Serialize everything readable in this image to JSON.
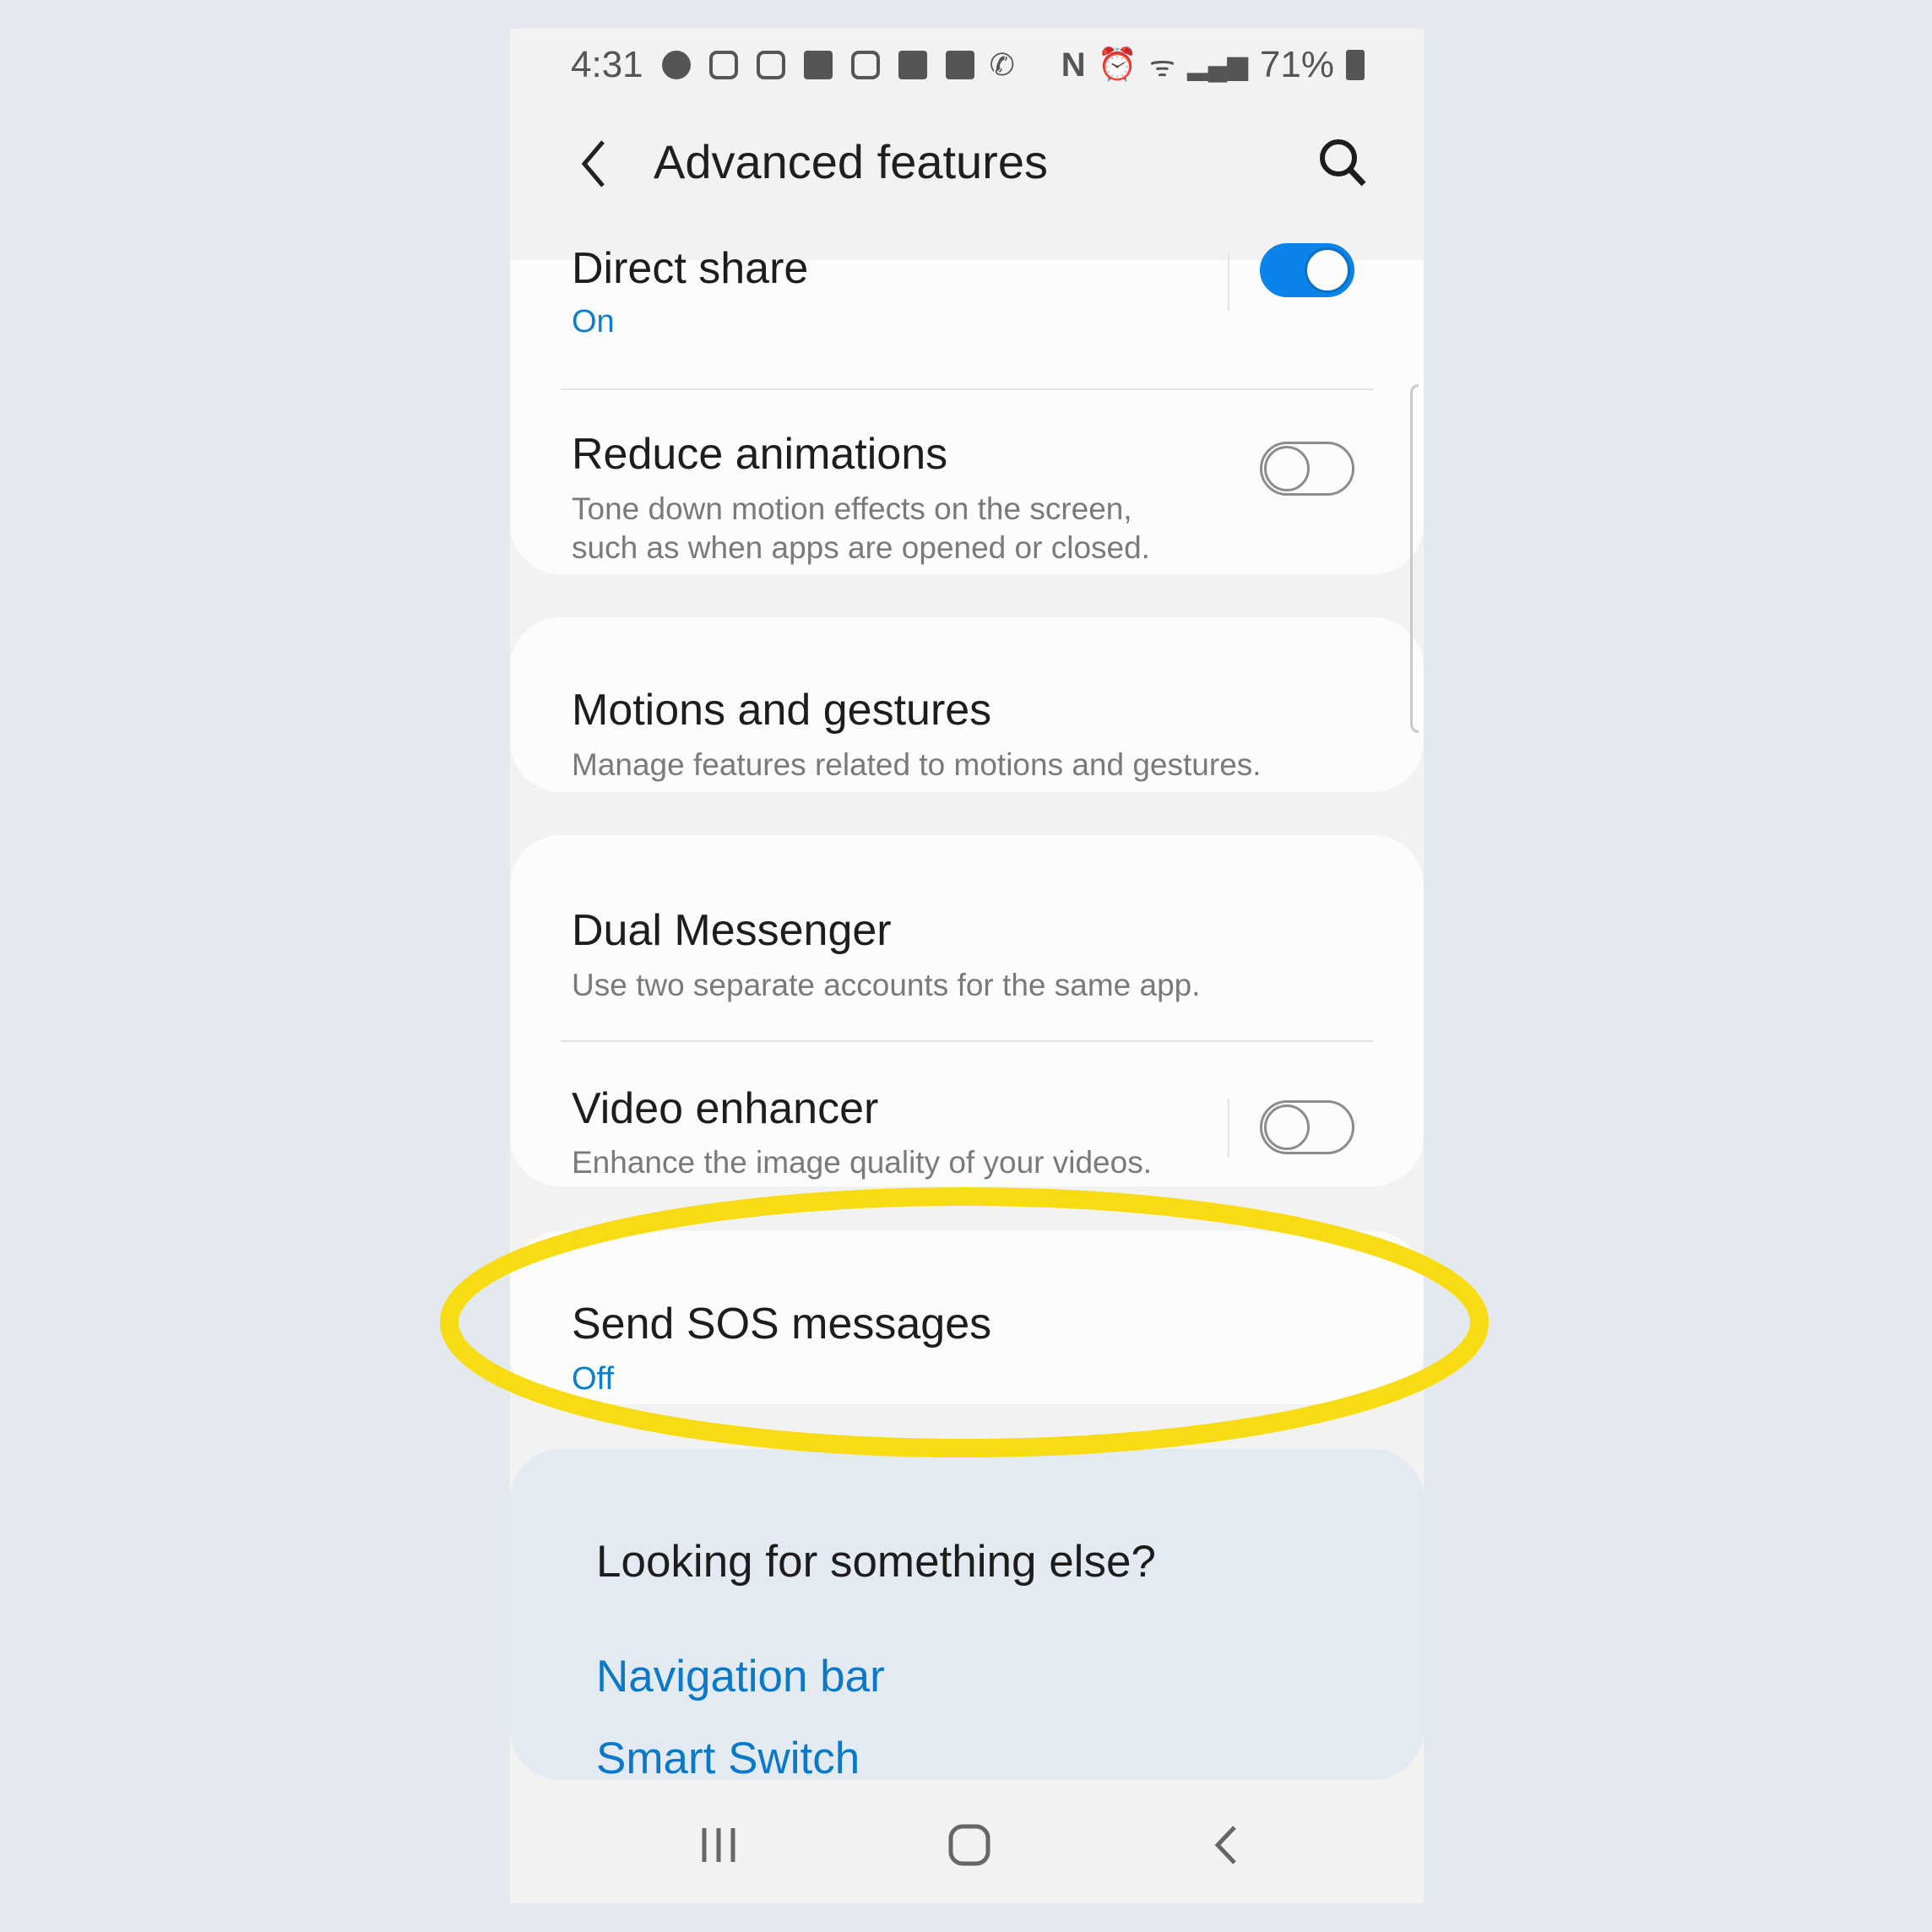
{
  "status_bar": {
    "time": "4:31",
    "battery": "71%",
    "notification_icons": [
      "music-icon",
      "instagram-icon",
      "instagram-icon",
      "message-icon",
      "instagram-icon",
      "email-icon",
      "gallery-icon",
      "call-icon"
    ],
    "system_icons": [
      "nfc-icon",
      "alarm-icon",
      "wifi-icon",
      "signal-icon",
      "battery-icon"
    ]
  },
  "header": {
    "title": "Advanced features",
    "back_icon": "chevron-left-icon",
    "search_icon": "search-icon"
  },
  "items": [
    {
      "title": "Direct share",
      "subtitle": "On",
      "toggle": true
    },
    {
      "title": "Reduce animations",
      "subtitle_lines": [
        "Tone down motion effects on the screen,",
        "such as when apps are opened or closed."
      ],
      "toggle": false
    },
    {
      "title": "Motions and gestures",
      "subtitle": "Manage features related to motions and gestures."
    },
    {
      "title": "Dual Messenger",
      "subtitle": "Use two separate accounts for the same app."
    },
    {
      "title": "Video enhancer",
      "subtitle": "Enhance the image quality of your videos.",
      "toggle": false
    },
    {
      "title": "Send SOS messages",
      "subtitle": "Off",
      "highlighted": true
    }
  ],
  "suggestions": {
    "heading": "Looking for something else?",
    "links": [
      "Navigation bar",
      "Smart Switch"
    ]
  },
  "colors": {
    "accent": "#0a7fd0",
    "highlight": "#f7dc13",
    "background": "#e4e9f0"
  },
  "nav_bar": {
    "icons": [
      "recents-icon",
      "home-icon",
      "back-icon"
    ]
  }
}
